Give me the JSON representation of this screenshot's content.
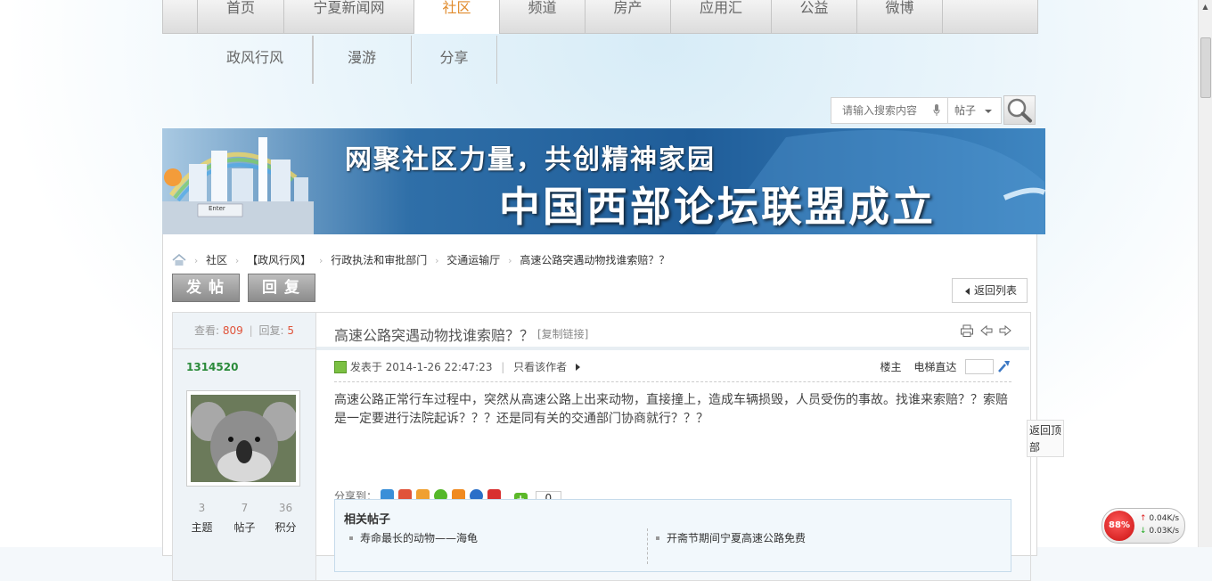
{
  "nav": {
    "items": [
      {
        "label": "首页"
      },
      {
        "label": "宁夏新闻网"
      },
      {
        "label": "社区"
      },
      {
        "label": "频道"
      },
      {
        "label": "房产"
      },
      {
        "label": "应用汇"
      },
      {
        "label": "公益"
      },
      {
        "label": "微博"
      }
    ],
    "active_index": 2,
    "sub_items": [
      {
        "label": "政风行风"
      },
      {
        "label": "漫游"
      },
      {
        "label": "分享"
      }
    ]
  },
  "search": {
    "placeholder": "请输入搜索内容",
    "type_label": "帖子"
  },
  "banner": {
    "line1": "网聚社区力量，共创精神家园",
    "line2": "中国西部论坛联盟成立",
    "enter_key": "Enter"
  },
  "breadcrumb": [
    "社区",
    "【政风行风】",
    "行政执法和审批部门",
    "交通运输厅",
    "高速公路突遇动物找谁索赔？？"
  ],
  "buttons": {
    "post": "发帖",
    "reply": "回复",
    "back_list": "返回列表"
  },
  "thread": {
    "views_label": "查看:",
    "views": "809",
    "replies_label": "回复:",
    "replies": "5",
    "title": "高速公路突遇动物找谁索赔？？",
    "copy_link": "[复制链接]"
  },
  "author": {
    "name": "1314520",
    "stats": [
      {
        "value": "3",
        "label": "主题"
      },
      {
        "value": "7",
        "label": "帖子"
      },
      {
        "value": "36",
        "label": "积分"
      }
    ]
  },
  "post": {
    "posted_at": "发表于 2014-1-26 22:47:23",
    "only_author": "只看该作者",
    "floor": "楼主",
    "floor_jump": "电梯直达",
    "body": "高速公路正常行车过程中，突然从高速公路上出来动物，直接撞上，造成车辆损毁，人员受伤的事故。找谁来索赔？？索赔是一定要进行法院起诉？？？还是同有关的交通部门协商就行？？？"
  },
  "share": {
    "label": "分享到：",
    "count": "0",
    "icons": [
      "qzone-icon",
      "weibo-icon",
      "tencent-weibo-icon",
      "wechat-icon",
      "favorite-icon",
      "renren-icon",
      "gift-icon",
      "more-plus-icon"
    ],
    "colors": [
      "#3a8fd8",
      "#e0533a",
      "#f0a030",
      "#55b82a",
      "#f08a20",
      "#2a6fc8",
      "#d83030",
      "#5cb82a"
    ]
  },
  "related": {
    "heading": "相关帖子",
    "items": [
      "寿命最长的动物——海龟",
      "开斋节期间宁夏高速公路免费"
    ]
  },
  "back_to_top": "返回顶部",
  "network": {
    "percent": "88%",
    "up": "0.04K/s",
    "down": "0.03K/s"
  }
}
